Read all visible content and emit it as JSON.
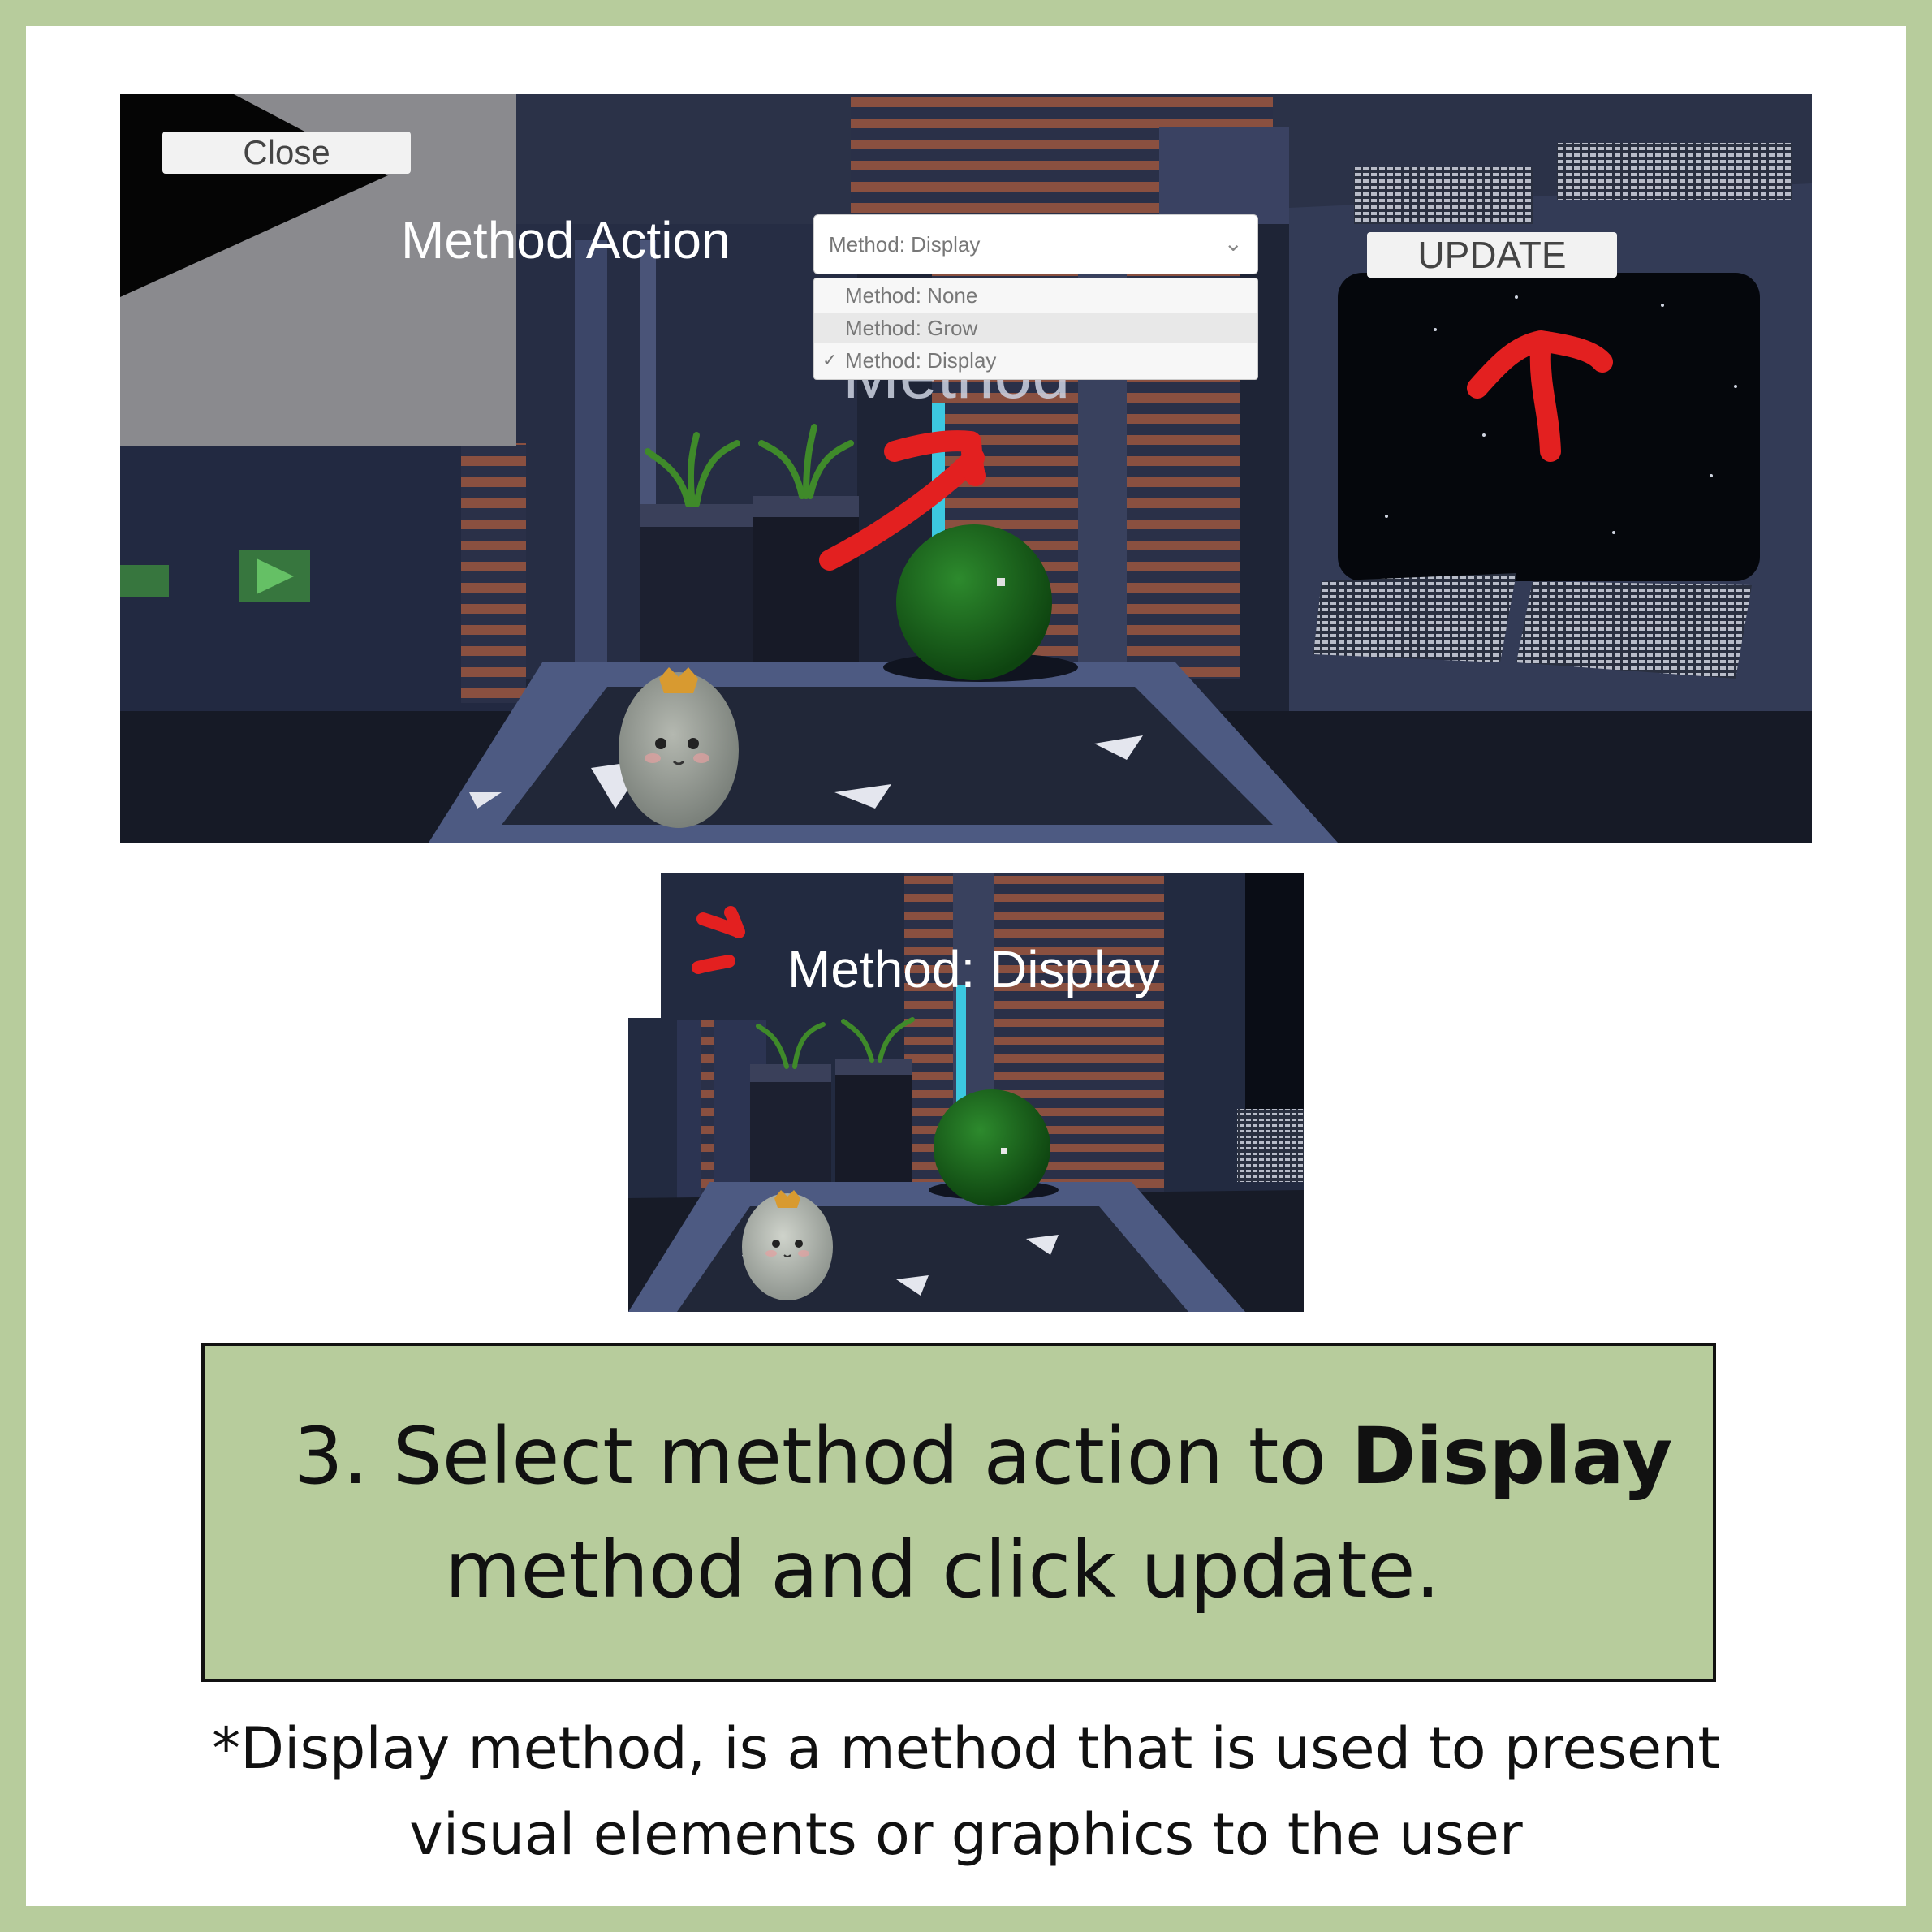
{
  "screenshot_top": {
    "close_label": "Close",
    "method_action_label": "Method Action",
    "dropdown": {
      "selected": "Method: Display",
      "options": [
        "Method: None",
        "Method: Grow",
        "Method: Display"
      ],
      "checked_option": "Method: Display"
    },
    "update_label": "UPDATE",
    "background_text": "Method"
  },
  "screenshot_bottom": {
    "result_label": "Method: Display"
  },
  "instruction": {
    "prefix": "3. Select method action to ",
    "bold": "Display",
    "line2": "method and click update."
  },
  "note": {
    "line1": "*Display method, is a method that is used to present",
    "line2": "visual elements or graphics to the user"
  },
  "colors": {
    "frame_green": "#b7cc9c",
    "annotation_red": "#e32020",
    "sphere_green": "#1d6b1d"
  }
}
